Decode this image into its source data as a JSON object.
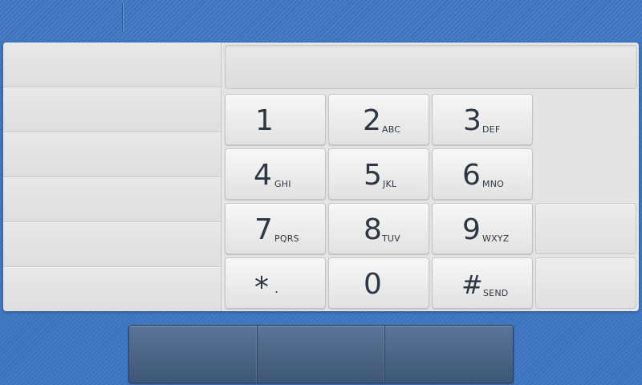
{
  "topbar": {
    "title": ""
  },
  "contacts": {
    "rows": [
      "",
      "",
      "",
      "",
      "",
      ""
    ]
  },
  "display": {
    "number": ""
  },
  "keypad": {
    "keys": [
      {
        "main": "1",
        "sub": ""
      },
      {
        "main": "2",
        "sub": "ABC"
      },
      {
        "main": "3",
        "sub": "DEF"
      },
      {
        "main": "4",
        "sub": "GHI"
      },
      {
        "main": "5",
        "sub": "JKL"
      },
      {
        "main": "6",
        "sub": "MNO"
      },
      {
        "main": "7",
        "sub": "PQRS"
      },
      {
        "main": "8",
        "sub": "TUV"
      },
      {
        "main": "9",
        "sub": "WXYZ"
      },
      {
        "main": "*",
        "sub": "."
      },
      {
        "main": "0",
        "sub": ""
      },
      {
        "main": "#",
        "sub": "SEND"
      }
    ]
  },
  "bottom_bar": {
    "buttons": [
      "",
      "",
      ""
    ]
  }
}
